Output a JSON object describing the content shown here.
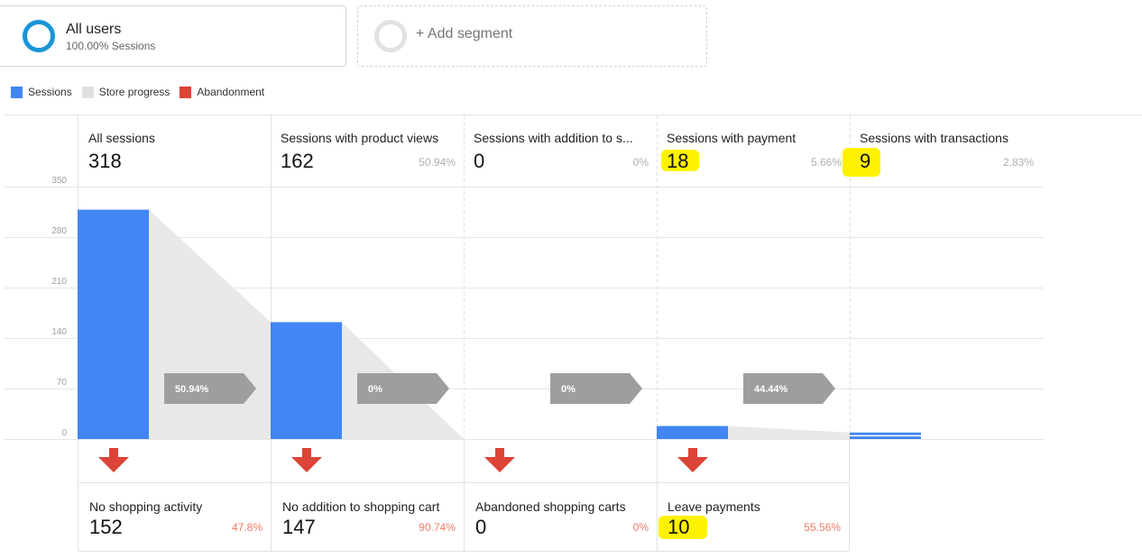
{
  "segments": {
    "all_users": {
      "title": "All users",
      "subtitle": "100.00% Sessions"
    },
    "add_segment": {
      "label": "+ Add segment"
    }
  },
  "legend": [
    {
      "label": "Sessions",
      "color": "#4285f4"
    },
    {
      "label": "Store progress",
      "color": "#e0e0e0"
    },
    {
      "label": "Abandonment",
      "color": "#db4437"
    }
  ],
  "colors": {
    "sessions": "#4285f4",
    "store_progress": "#e8e8e8",
    "abandonment": "#db4437",
    "arrow": "#9e9e9e",
    "highlight": "#fff200"
  },
  "chart_data": {
    "type": "bar",
    "ylim": [
      0,
      350
    ],
    "y_ticks": [
      "350",
      "280",
      "210",
      "140",
      "70",
      "0"
    ],
    "categories": [
      "All sessions",
      "Sessions with product views",
      "Sessions with addition to s...",
      "Sessions with payment",
      "Sessions with transactions"
    ],
    "series": [
      {
        "name": "Sessions",
        "values": [
          318,
          162,
          0,
          18,
          9
        ]
      }
    ],
    "progress_labels": [
      "50.94%",
      "0%",
      "0%",
      "44.44%"
    ]
  },
  "steps": [
    {
      "name": "All sessions",
      "value": "318",
      "pct": ""
    },
    {
      "name": "Sessions with product views",
      "value": "162",
      "pct": "50.94%"
    },
    {
      "name": "Sessions with addition to s...",
      "value": "0",
      "pct": "0%"
    },
    {
      "name": "Sessions with payment",
      "value": "18",
      "pct": "5.66%"
    },
    {
      "name": "Sessions with transactions",
      "value": "9",
      "pct": "2.83%"
    }
  ],
  "abandonment": [
    {
      "name": "No shopping activity",
      "value": "152",
      "pct": "47.8%"
    },
    {
      "name": "No addition to shopping cart",
      "value": "147",
      "pct": "90.74%"
    },
    {
      "name": "Abandoned shopping carts",
      "value": "0",
      "pct": "0%"
    },
    {
      "name": "Leave payments",
      "value": "10",
      "pct": "55.56%"
    }
  ]
}
